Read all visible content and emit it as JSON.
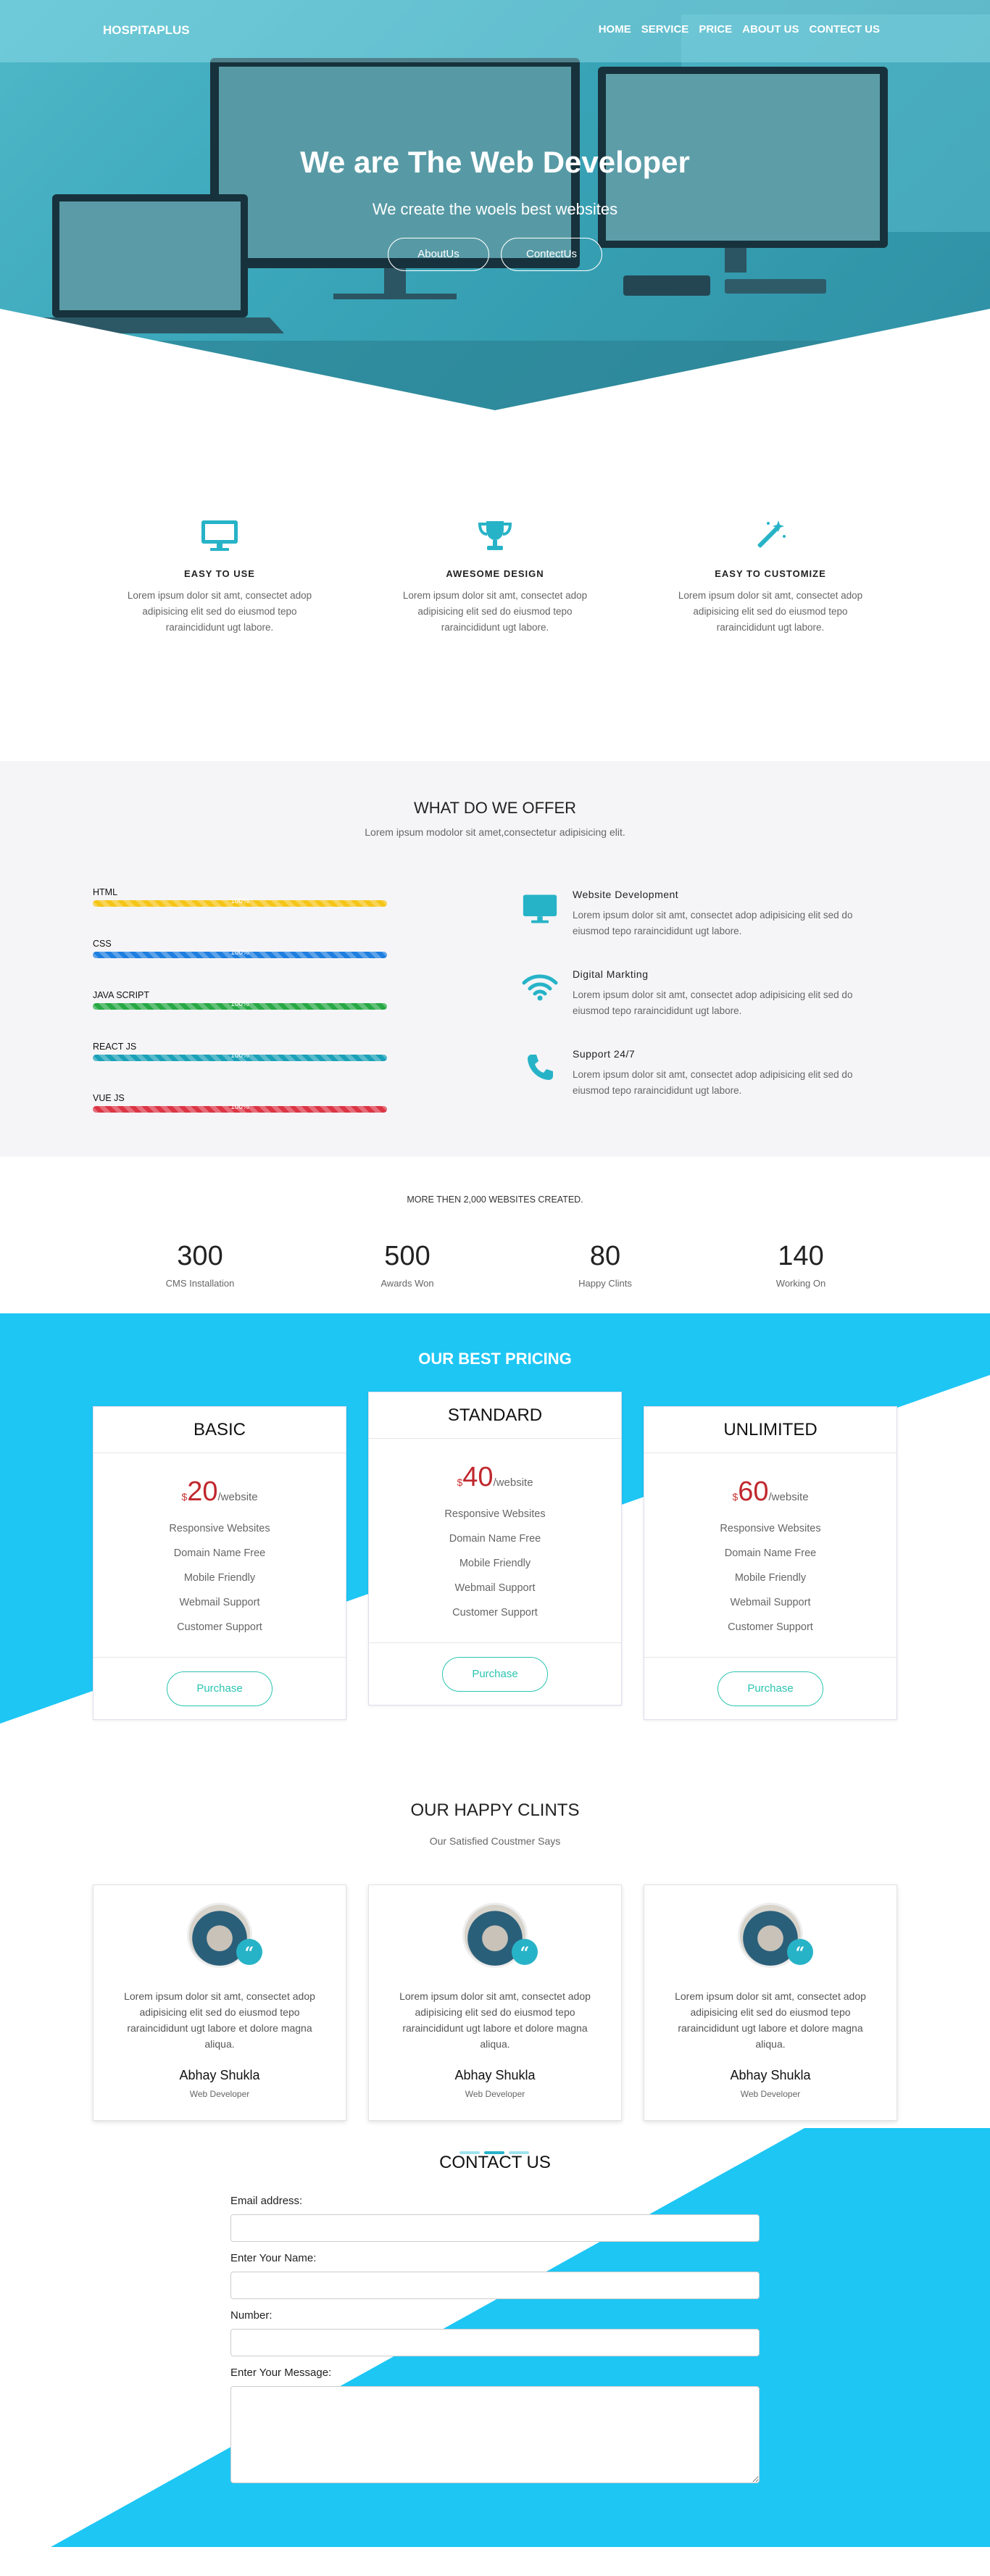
{
  "nav": {
    "brand": "HOSPITAPLUS",
    "items": [
      "HOME",
      "SERVICE",
      "PRICE",
      "ABOUT US",
      "CONTECT US"
    ]
  },
  "hero": {
    "title": "We are The Web Developer",
    "subtitle": "We create the woels best websites",
    "buttons": [
      "AboutUs",
      "ContectUs"
    ]
  },
  "features": [
    {
      "icon": "monitor-icon",
      "title": "EASY  TO  USE",
      "text": "Lorem ipsum dolor sit amt, consectet adop adipisicing elit sed do eiusmod tepo raraincididunt ugt labore."
    },
    {
      "icon": "trophy-icon",
      "title": "AWESOME  DESIGN",
      "text": "Lorem ipsum dolor sit amt, consectet adop adipisicing elit sed do eiusmod tepo raraincididunt ugt labore."
    },
    {
      "icon": "magic-wand-icon",
      "title": "EASY  TO  CUSTOMIZE",
      "text": "Lorem ipsum dolor sit amt, consectet adop adipisicing elit sed do eiusmod tepo raraincididunt ugt labore."
    }
  ],
  "offer": {
    "title": "WHAT DO WE OFFER",
    "subtitle": "Lorem ipsum modolor sit amet,consectetur adipisicing elit.",
    "skills": [
      {
        "label": "HTML",
        "percent": "100%",
        "color": "#f5c518"
      },
      {
        "label": "CSS",
        "percent": "100%",
        "color": "#1e7fe0"
      },
      {
        "label": "JAVA SCRIPT",
        "percent": "100%",
        "color": "#27a844"
      },
      {
        "label": "REACT JS",
        "percent": "100%",
        "color": "#1aa1b8"
      },
      {
        "label": "VUE JS",
        "percent": "100%",
        "color": "#dc3545"
      }
    ],
    "services": [
      {
        "icon": "monitor-icon",
        "title": "Website  Development",
        "text": "Lorem ipsum dolor sit amt, consectet adop adipisicing elit sed do eiusmod tepo raraincididunt ugt labore."
      },
      {
        "icon": "wifi-icon",
        "title": "Digital  Markting",
        "text": "Lorem ipsum dolor sit amt, consectet adop adipisicing elit sed do eiusmod tepo raraincididunt ugt labore."
      },
      {
        "icon": "phone-icon",
        "title": "Support  24/7",
        "text": "Lorem ipsum dolor sit amt, consectet adop adipisicing elit sed do eiusmod tepo raraincididunt ugt labore."
      }
    ]
  },
  "stats": {
    "caption": "MORE THEN 2,000 WEBSITES CREATED.",
    "items": [
      {
        "number": "300",
        "label": "CMS Installation"
      },
      {
        "number": "500",
        "label": "Awards Won"
      },
      {
        "number": "80",
        "label": "Happy Clints"
      },
      {
        "number": "140",
        "label": "Working On"
      }
    ]
  },
  "pricing": {
    "title": "OUR BEST PRICING",
    "currency": "$",
    "per": "/website",
    "button": "Purchase",
    "features": [
      "Responsive Websites",
      "Domain Name Free",
      "Mobile Friendly",
      "Webmail Support",
      "Customer Support"
    ],
    "plans": [
      {
        "name": "BASIC",
        "amount": "20"
      },
      {
        "name": "STANDARD",
        "amount": "40"
      },
      {
        "name": "UNLIMITED",
        "amount": "60"
      }
    ]
  },
  "testimonials": {
    "title": "OUR HAPPY CLINTS",
    "subtitle": "Our Satisfied Coustmer Says",
    "quote_glyph": "“",
    "items": [
      {
        "text": "Lorem ipsum dolor sit amt, consectet adop adipisicing elit sed do eiusmod tepo raraincididunt ugt labore et dolore magna aliqua.",
        "name": "Abhay Shukla",
        "role": "Web Developer"
      },
      {
        "text": "Lorem ipsum dolor sit amt, consectet adop adipisicing elit sed do eiusmod tepo raraincididunt ugt labore et dolore magna aliqua.",
        "name": "Abhay Shukla",
        "role": "Web Developer"
      },
      {
        "text": "Lorem ipsum dolor sit amt, consectet adop adipisicing elit sed do eiusmod tepo raraincididunt ugt labore et dolore magna aliqua.",
        "name": "Abhay Shukla",
        "role": "Web Developer"
      }
    ]
  },
  "contact": {
    "title": "CONTACT US",
    "labels": [
      "Email address:",
      "Enter Your Name:",
      "Number:",
      "Enter Your Message:"
    ]
  },
  "colors": {
    "accent": "#1ec6f4",
    "teal": "#2bc4b1",
    "price_red": "#c0272d"
  }
}
